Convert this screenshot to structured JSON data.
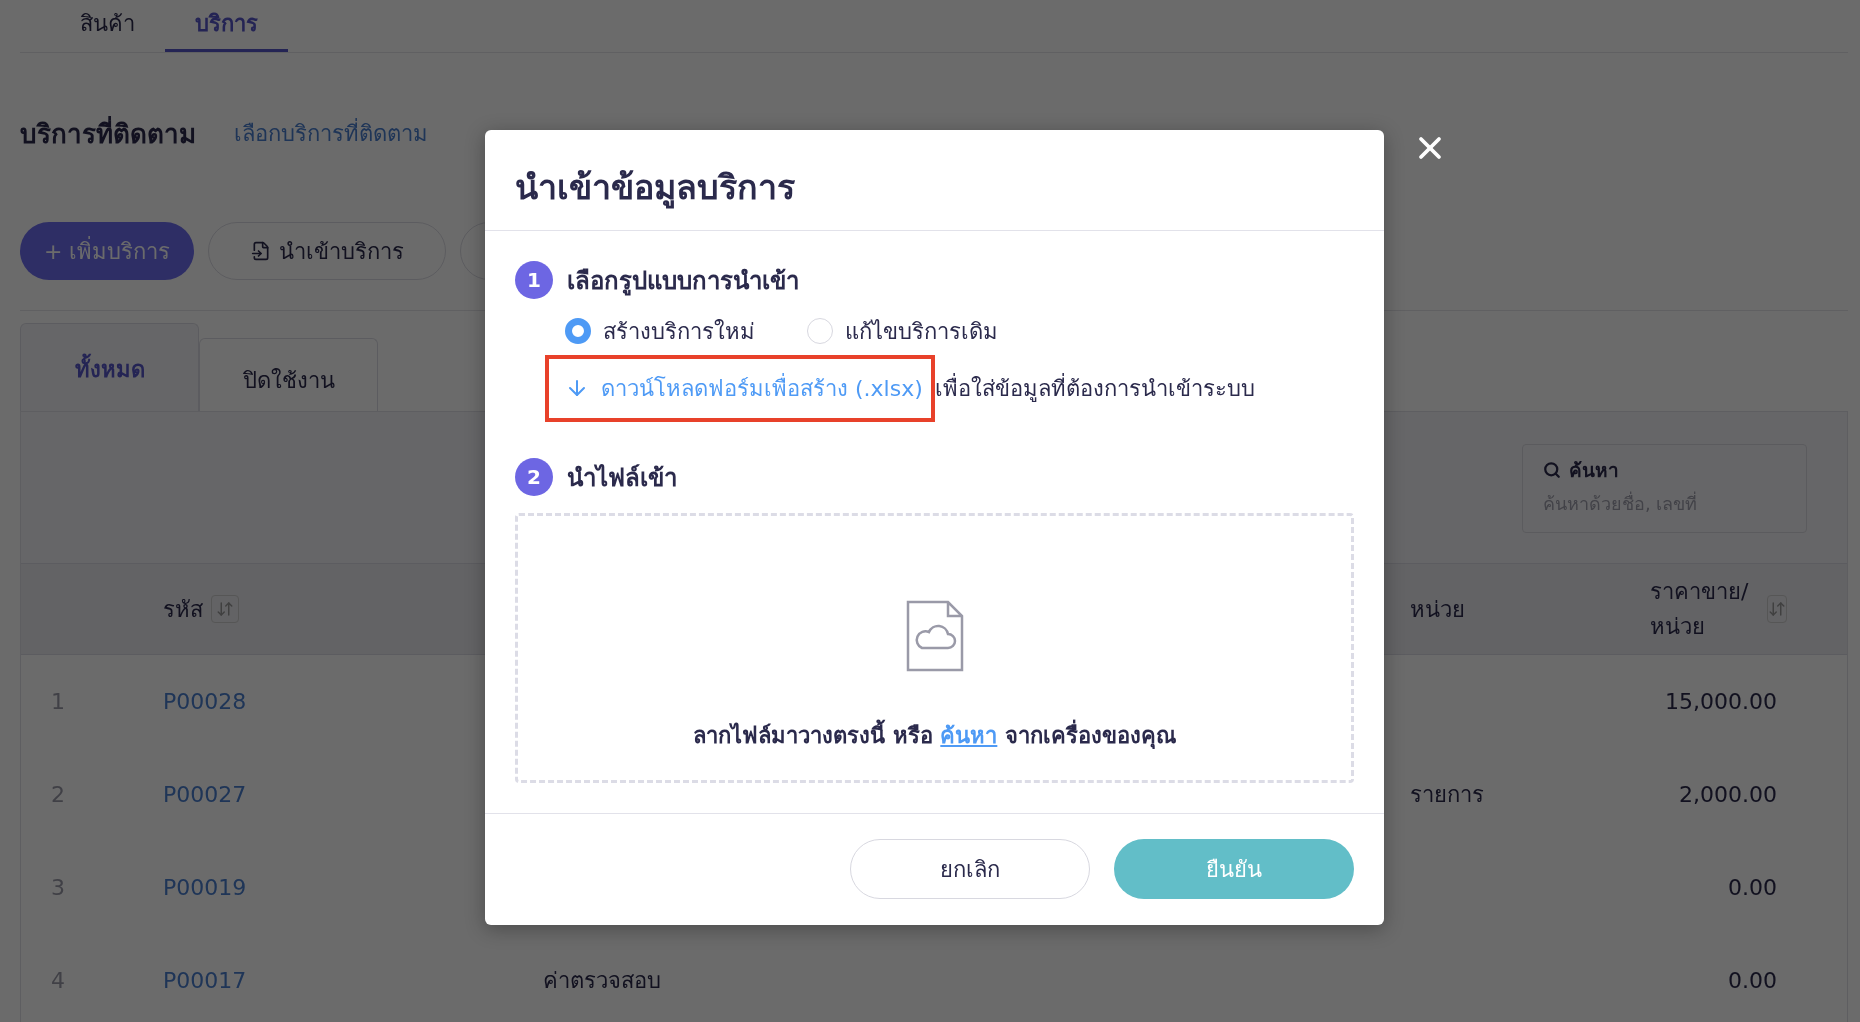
{
  "top_tabs": [
    {
      "label": "สินค้า",
      "selected": false
    },
    {
      "label": "บริการ",
      "selected": true
    }
  ],
  "heading": "บริการที่ติดตาม",
  "heading_link": "เลือกบริการที่ติดตาม",
  "toolbar": [
    {
      "kind": "primary",
      "label": "+ เพิ่มบริการ"
    },
    {
      "kind": "import",
      "label": "นำเข้าบริการ"
    },
    {
      "kind": "covered"
    }
  ],
  "status_tabs": [
    {
      "label": "ทั้งหมด",
      "selected": true
    },
    {
      "label": "ปิดใช้งาน",
      "selected": false
    }
  ],
  "search": {
    "label": "ค้นหา",
    "placeholder": "ค้นหาด้วยชื่อ, เลขที่"
  },
  "table": {
    "columns": [
      {
        "kind": "code",
        "label": "รหัส",
        "sortable": true
      },
      {
        "kind": "unit",
        "label": "หน่วย",
        "sortable": false
      },
      {
        "kind": "price",
        "label": "ราคาขาย/หน่วย",
        "sortable": true
      }
    ],
    "rows": [
      {
        "index": "1",
        "code": "P00028",
        "price": "15,000.00"
      },
      {
        "index": "2",
        "code": "P00027",
        "unit": "รายการ",
        "price": "2,000.00"
      },
      {
        "index": "3",
        "code": "P00019",
        "price": "0.00"
      },
      {
        "index": "4",
        "code": "P00017",
        "name": "ค่าตรวจสอบ",
        "price": "0.00"
      }
    ]
  },
  "modal": {
    "title": "นำเข้าข้อมูลบริการ",
    "steps": [
      {
        "number": "1",
        "title": "เลือกรูปแบบการนำเข้า"
      },
      {
        "number": "2",
        "title": "นำไฟล์เข้า"
      }
    ],
    "options": [
      {
        "label": "สร้างบริการใหม่",
        "selected": true
      },
      {
        "label": "แก้ไขบริการเดิม",
        "selected": false
      }
    ],
    "download_link": "ดาวน์โหลดฟอร์มเพื่อสร้าง (.xlsx)",
    "download_highlighted": true,
    "download_note": "เพื่อใส่ข้อมูลที่ต้องการนำเข้าระบบ",
    "dropzone": {
      "text_before": "ลากไฟล์มาวางตรงนี้ หรือ",
      "link": "ค้นหา",
      "text_after": "จากเครื่องของคุณ"
    },
    "buttons": [
      {
        "kind": "cancel",
        "label": "ยกเลิก"
      },
      {
        "kind": "confirm",
        "label": "ยืนยัน"
      }
    ]
  }
}
